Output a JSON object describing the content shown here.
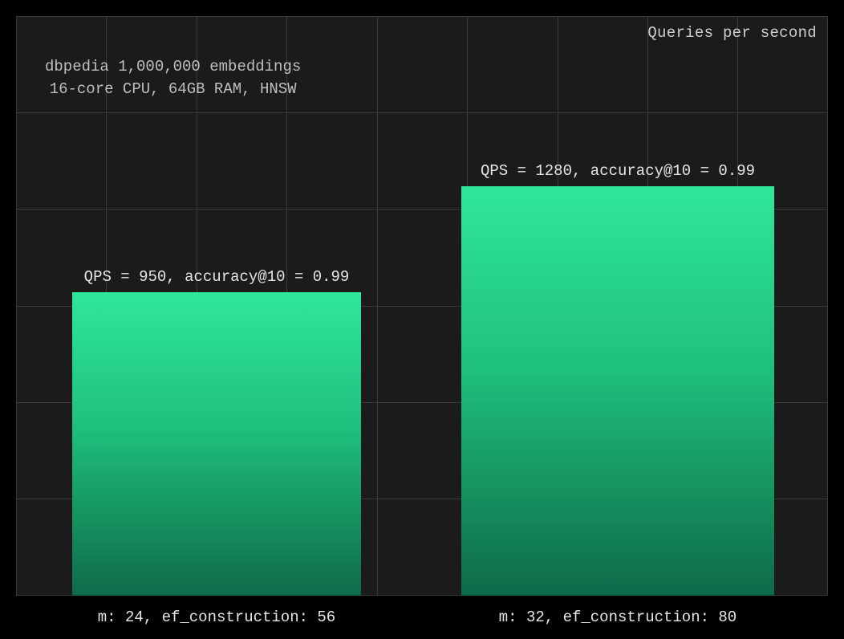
{
  "chart_data": {
    "type": "bar",
    "title": "Queries per second",
    "subtitle_line1": "dbpedia 1,000,000 embeddings",
    "subtitle_line2": "16-core CPU, 64GB RAM, HNSW",
    "ylabel": "",
    "xlabel": "",
    "ylim": [
      0,
      1400
    ],
    "categories": [
      "m: 24, ef_construction: 56",
      "m: 32, ef_construction: 80"
    ],
    "values": [
      950,
      1280
    ],
    "series": [
      {
        "name": "QPS",
        "values": [
          950,
          1280
        ],
        "accuracy_at_10": [
          0.99,
          0.99
        ]
      }
    ],
    "bar_labels": [
      "QPS = 950, accuracy@10 = 0.99",
      "QPS = 1280, accuracy@10 = 0.99"
    ],
    "colors": {
      "bar_top": "#2fe79a",
      "bar_bottom": "#0e6a48",
      "background": "#1b1b1b",
      "page_background": "#000000",
      "text": "#e6e6e6",
      "grid": "#3a3a3a"
    }
  }
}
